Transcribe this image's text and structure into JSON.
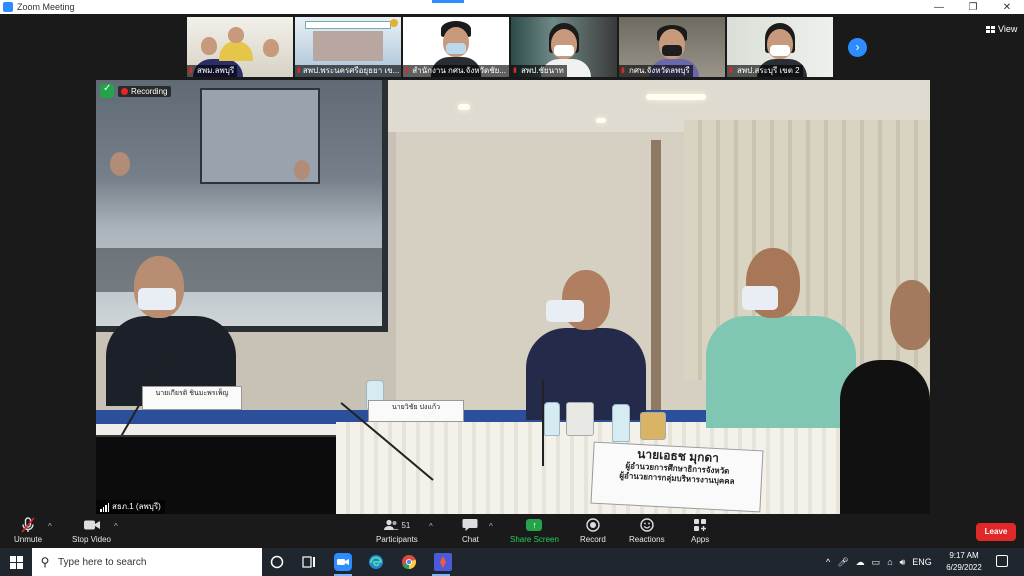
{
  "window": {
    "title": "Zoom Meeting",
    "minimize_glyph": "—",
    "restore_glyph": "❐",
    "close_glyph": "✕"
  },
  "gallery": {
    "participants": [
      {
        "name": "สพม.ลพบุรี",
        "icon": "muted-mic-icon"
      },
      {
        "name": "สพป.พระนครศรีอยุธยา เข...",
        "icon": "muted-mic-icon"
      },
      {
        "name": "สำนักงาน กศน.จังหวัดชัย...",
        "icon": "muted-mic-icon"
      },
      {
        "name": "สพป.ชัยนาท",
        "icon": "muted-mic-icon"
      },
      {
        "name": "กศน.จังหวัดลพบุรี",
        "icon": "muted-mic-icon"
      },
      {
        "name": "สพป.สระบุรี เขต 2",
        "icon": "muted-mic-icon"
      }
    ],
    "next_glyph": "›"
  },
  "view_button": {
    "label": "View"
  },
  "recording": {
    "label": "Recording"
  },
  "speaker": {
    "name": "สธภ.1 (ลพบุรี)"
  },
  "scene": {
    "nameplates": {
      "left": "นายเกียรติ   ชินมะพรเพ็ญ",
      "center": "นายวิชัย ปงแก้ว",
      "right_line1": "นายเอธช   มุกดา",
      "right_line2": "ผู้อำนวยการศึกษาธิการจังหวัด",
      "right_line3": "ผู้อำนวยการกลุ่มบริหารงานบุคคล"
    }
  },
  "toolbar": {
    "unmute": "Unmute",
    "stop_video": "Stop Video",
    "participants": "Participants",
    "participant_count": "51",
    "chat": "Chat",
    "share_screen": "Share Screen",
    "record": "Record",
    "reactions": "Reactions",
    "apps": "Apps",
    "leave": "Leave"
  },
  "taskbar": {
    "search_placeholder": "Type here to search",
    "language": "ENG",
    "time": "9:17 AM",
    "date": "6/29/2022"
  },
  "colors": {
    "accent": "#2d8cff",
    "leave": "#e02828",
    "share": "#23a44a",
    "tablecloth": "#2b4f9a"
  }
}
